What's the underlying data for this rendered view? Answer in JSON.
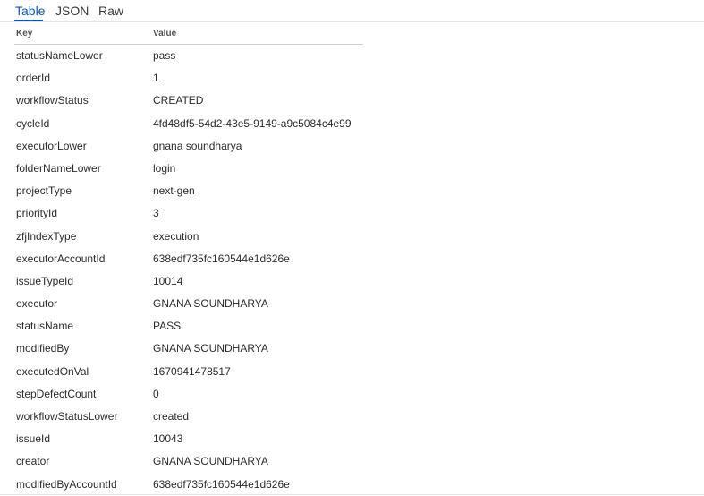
{
  "tabs": [
    {
      "label": "Table",
      "active": true
    },
    {
      "label": "JSON",
      "active": false
    },
    {
      "label": "Raw",
      "active": false
    }
  ],
  "table": {
    "headers": {
      "key": "Key",
      "value": "Value"
    },
    "rows": [
      {
        "key": "statusNameLower",
        "value": "pass"
      },
      {
        "key": "orderId",
        "value": "1"
      },
      {
        "key": "workflowStatus",
        "value": "CREATED"
      },
      {
        "key": "cycleId",
        "value": "4fd48df5-54d2-43e5-9149-a9c5084c4e99"
      },
      {
        "key": "executorLower",
        "value": "gnana soundharya"
      },
      {
        "key": "folderNameLower",
        "value": "login"
      },
      {
        "key": "projectType",
        "value": "next-gen"
      },
      {
        "key": "priorityId",
        "value": "3"
      },
      {
        "key": "zfjIndexType",
        "value": "execution"
      },
      {
        "key": "executorAccountId",
        "value": "638edf735fc160544e1d626e"
      },
      {
        "key": "issueTypeId",
        "value": "10014"
      },
      {
        "key": "executor",
        "value": "GNANA SOUNDHARYA"
      },
      {
        "key": "statusName",
        "value": "PASS"
      },
      {
        "key": "modifiedBy",
        "value": "GNANA SOUNDHARYA"
      },
      {
        "key": "executedOnVal",
        "value": "1670941478517"
      },
      {
        "key": "stepDefectCount",
        "value": "0"
      },
      {
        "key": "workflowStatusLower",
        "value": "created"
      },
      {
        "key": "issueId",
        "value": "10043"
      },
      {
        "key": "creator",
        "value": "GNANA SOUNDHARYA"
      },
      {
        "key": "modifiedByAccountId",
        "value": "638edf735fc160544e1d626e"
      }
    ]
  },
  "colors": {
    "accent": "#0a59b8"
  }
}
